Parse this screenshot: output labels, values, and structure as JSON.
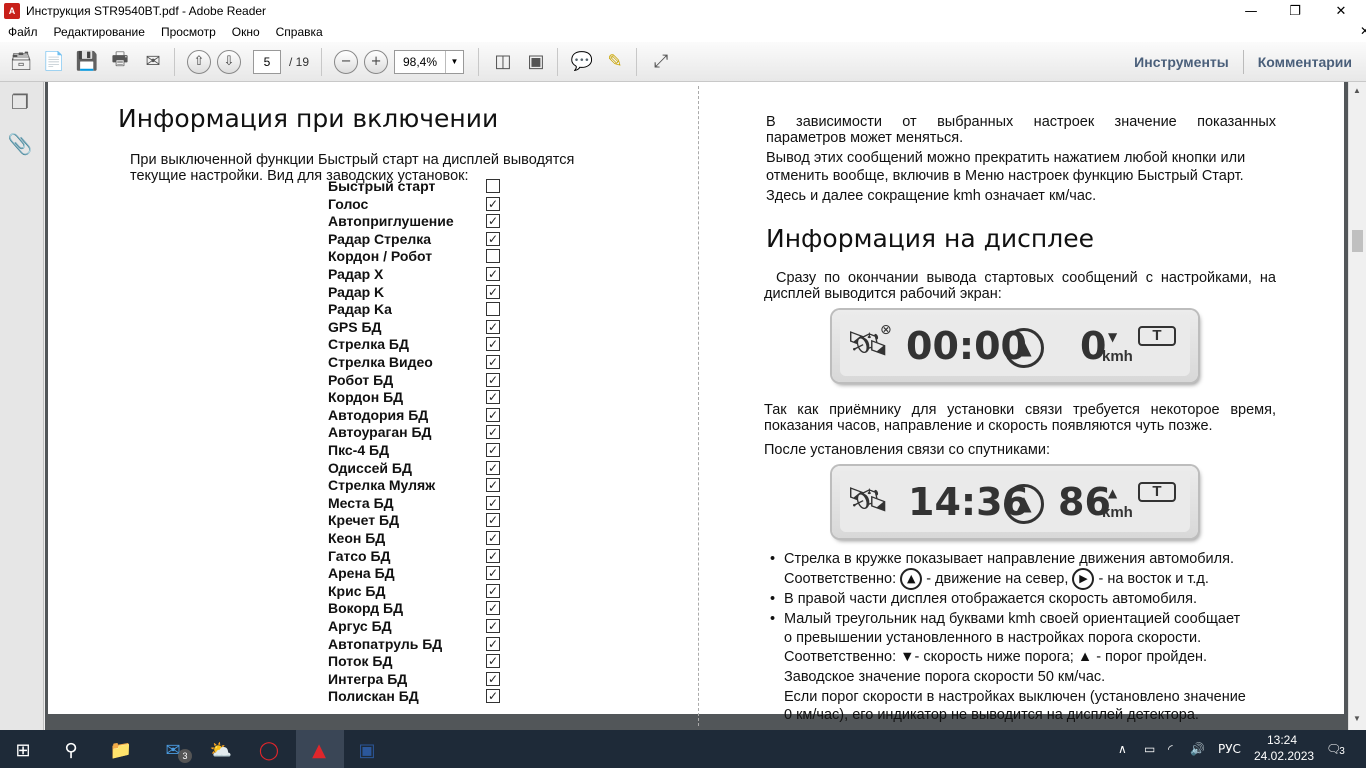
{
  "window": {
    "title": "Инструкция STR9540BT.pdf - Adobe Reader",
    "app_icon_label": "A"
  },
  "menubar": [
    "Файл",
    "Редактирование",
    "Просмотр",
    "Окно",
    "Справка"
  ],
  "toolbar": {
    "page_current": "5",
    "page_total": "/ 19",
    "zoom": "98,4%",
    "tools_label": "Инструменты",
    "comments_label": "Комментарии"
  },
  "left_page": {
    "heading": "Информация при включении",
    "intro_line1": "При выключенной функции Быстрый старт  на дисплей выводятся",
    "intro_line2": "текущие настройки. Вид для заводских установок:",
    "settings": [
      {
        "label": "Быстрый старт",
        "checked": false
      },
      {
        "label": "Голос",
        "checked": true
      },
      {
        "label": "Автоприглушение",
        "checked": true
      },
      {
        "label": "Радар Стрелка",
        "checked": true
      },
      {
        "label": "Кордон / Робот",
        "checked": false
      },
      {
        "label": "Радар X",
        "checked": true
      },
      {
        "label": "Радар K",
        "checked": true
      },
      {
        "label": "Радар Ka",
        "checked": false
      },
      {
        "label": "GPS БД",
        "checked": true
      },
      {
        "label": "Стрелка БД",
        "checked": true
      },
      {
        "label": "Стрелка Видео",
        "checked": true
      },
      {
        "label": "Робот БД",
        "checked": true
      },
      {
        "label": "Кордон БД",
        "checked": true
      },
      {
        "label": "Автодория БД",
        "checked": true
      },
      {
        "label": "Автоураган БД",
        "checked": true
      },
      {
        "label": "Пкс-4  БД",
        "checked": true
      },
      {
        "label": "Одиссей БД",
        "checked": true
      },
      {
        "label": "Стрелка Муляж",
        "checked": true
      },
      {
        "label": "Места БД",
        "checked": true
      },
      {
        "label": "Кречет БД",
        "checked": true
      },
      {
        "label": "Кеон БД",
        "checked": true
      },
      {
        "label": "Гатсо БД",
        "checked": true
      },
      {
        "label": "Арена БД",
        "checked": true
      },
      {
        "label": "Крис БД",
        "checked": true
      },
      {
        "label": "Вокорд БД",
        "checked": true
      },
      {
        "label": "Аргус БД",
        "checked": true
      },
      {
        "label": "Автопатруль БД",
        "checked": true
      },
      {
        "label": "Поток БД",
        "checked": true
      },
      {
        "label": "Интегра БД",
        "checked": true
      },
      {
        "label": "Полискан БД",
        "checked": true
      }
    ],
    "check_mark": "✓"
  },
  "right_page": {
    "p1_line1": "В   зависимости   от   выбранных   настроек   значение   показанных",
    "p1_line2": "параметров может меняться.",
    "p2_line1": "Вывод этих сообщений можно прекратить нажатием любой кнопки или",
    "p2_line2": "отменить вообще, включив в Меню настроек функцию Быстрый Старт.",
    "p3": "Здесь и  далее сокращение kmh означает км/час.",
    "heading": "Информация на дисплее",
    "p4_line1": "Сразу по окончании вывода стартовых сообщений с настройками, на",
    "p4_line2": "дисплей выводится рабочий экран:",
    "display1": {
      "time": "00:00",
      "speed": "0",
      "unit": "kmh",
      "t_label": "T",
      "arrow": "▼"
    },
    "p5_line1": "Так  как  приёмнику  для  установки  связи  требуется некоторое время,",
    "p5_line2": "показания часов, направление и скорость появляются чуть позже.",
    "p6": "После установления связи со спутниками:",
    "display2": {
      "time": "14:36",
      "speed": "86",
      "unit": "kmh",
      "t_label": "T",
      "arrow": "▲"
    },
    "b1_line1": "Стрелка в кружке показывает направление движения автомобиля.",
    "b1_line2a": "Соответственно:",
    "b1_line2b": "- движение на север,",
    "b1_line2c": "-  на восток и т.д.",
    "b2": "В правой части дисплея отображается скорость автомобиля.",
    "b3_line1": "Малый треугольник над буквами  kmh  своей ориентацией сообщает",
    "b3_line2": "о превышении установленного в настройках порога скорости.",
    "b3_line3": "Соответственно: ▼- скорость ниже порога;  ▲ - порог пройден.",
    "b3_line4": "Заводское значение порога скорости 50 км/час.",
    "b3_line5": "Если порог скорости в настройках выключен (установлено значение",
    "b3_line6": "0 км/час), его индикатор не выводится на дисплей детектора."
  },
  "taskbar": {
    "mail_badge": "3",
    "lang": "РУС",
    "time": "13:24",
    "date": "24.02.2023",
    "notif_count": "3"
  }
}
